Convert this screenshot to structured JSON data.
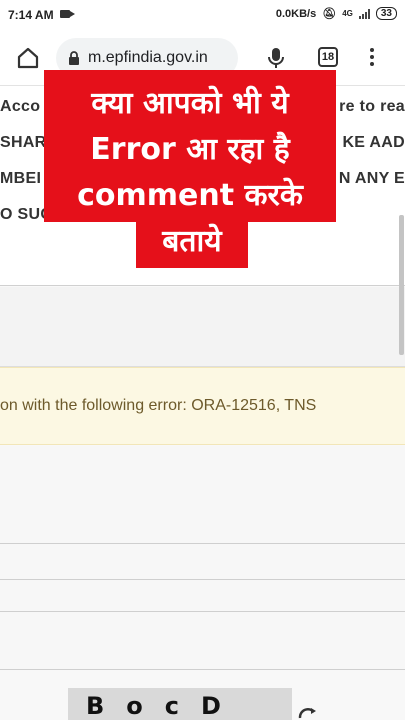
{
  "status_bar": {
    "time": "7:14 AM",
    "net_speed": "0.0KB/s",
    "network": "4G",
    "battery": "33"
  },
  "browser": {
    "url": "m.epfindia.gov.in",
    "tab_count": "18"
  },
  "page": {
    "lines": [
      {
        "left": "Acco",
        "right": "re to rea"
      },
      {
        "left": "SHAR",
        "right": "KE AAD"
      },
      {
        "left": "MBEI",
        "right": "N ANY E"
      },
      {
        "left": "O SUCH",
        "right": ""
      }
    ],
    "error_message": "on with the following error: ORA-12516, TNS"
  },
  "overlay": {
    "lines": [
      "क्या आपको भी ये",
      "Error आ रहा है",
      "comment करके"
    ],
    "last_line": "बताये",
    "color": "#e5101a"
  },
  "captcha": {
    "text": "BocD"
  }
}
